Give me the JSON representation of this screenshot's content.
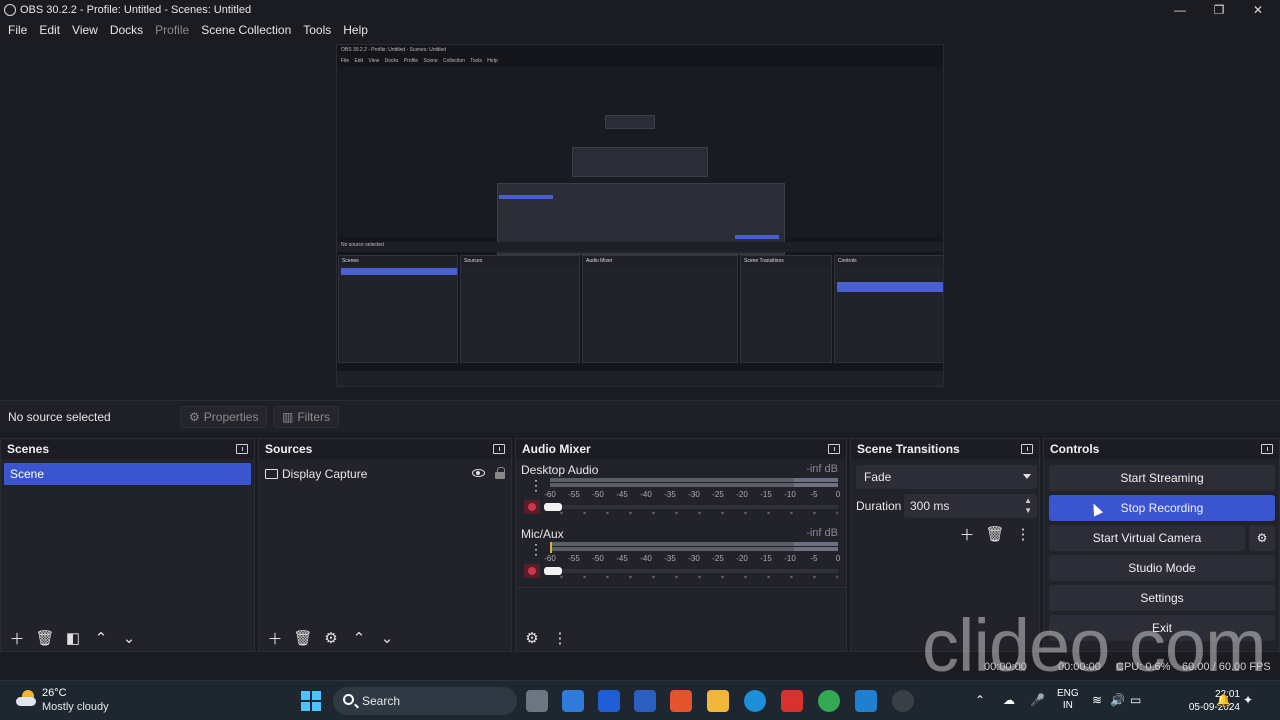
{
  "window": {
    "title": "OBS 30.2.2 - Profile: Untitled - Scenes: Untitled",
    "minimize": "—",
    "maximize": "❐",
    "close": "✕"
  },
  "menu": [
    "File",
    "Edit",
    "View",
    "Docks",
    "Profile",
    "Scene Collection",
    "Tools",
    "Help"
  ],
  "preview": {
    "title": "OBS 30.2.2 - Profile: Untitled - Scenes: Untitled",
    "menu": "File Edit View Docks Profile Scene Collection Tools Help",
    "no_source": "No source selected",
    "docks": [
      "Scenes",
      "Sources",
      "Audio Mixer",
      "Scene Transitions",
      "Controls"
    ]
  },
  "source_bar": {
    "no_source": "No source selected",
    "properties": "Properties",
    "filters": "Filters"
  },
  "scenes": {
    "title": "Scenes",
    "items": [
      "Scene"
    ]
  },
  "sources": {
    "title": "Sources",
    "items": [
      "Display Capture"
    ]
  },
  "mixer": {
    "title": "Audio Mixer",
    "channels": [
      {
        "name": "Desktop Audio",
        "level": "-inf dB"
      },
      {
        "name": "Mic/Aux",
        "level": "-inf dB"
      }
    ],
    "ticks": [
      "-60",
      "-55",
      "-50",
      "-45",
      "-40",
      "-35",
      "-30",
      "-25",
      "-20",
      "-15",
      "-10",
      "-5",
      "0"
    ]
  },
  "transitions": {
    "title": "Scene Transitions",
    "selected": "Fade",
    "duration_label": "Duration",
    "duration_value": "300 ms"
  },
  "controls": {
    "title": "Controls",
    "buttons": [
      "Start Streaming",
      "Stop Recording",
      "Start Virtual Camera",
      "Studio Mode",
      "Settings",
      "Exit"
    ]
  },
  "status": {
    "rec_time": "00:00:00",
    "stream_time": "00:00:00",
    "cpu": "CPU: 0.6%",
    "fps": "60.00 / 60.00 FPS"
  },
  "watermark": "clideo.com",
  "taskbar": {
    "temp": "26°C",
    "weather": "Mostly cloudy",
    "search": "Search",
    "lang1": "ENG",
    "lang2": "IN",
    "time": "22:01",
    "date": "05-09-2024"
  }
}
